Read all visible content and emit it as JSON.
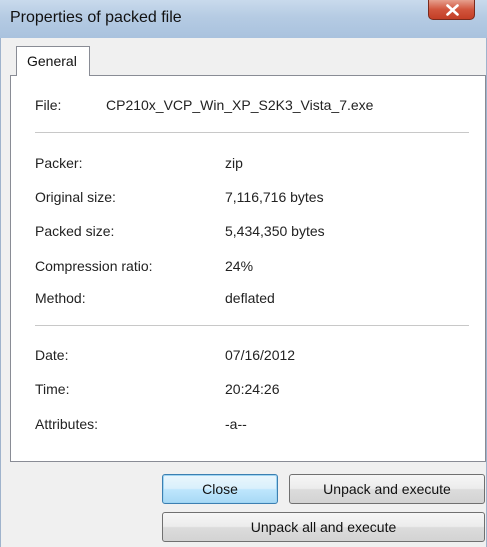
{
  "window": {
    "title": "Properties of packed file",
    "close_glyph": "X"
  },
  "tabs": [
    {
      "label": "General"
    }
  ],
  "file": {
    "label": "File:",
    "value": "CP210x_VCP_Win_XP_S2K3_Vista_7.exe"
  },
  "archive": {
    "packer_label": "Packer:",
    "packer_value": "zip",
    "original_size_label": "Original size:",
    "original_size_value": "7,116,716 bytes",
    "packed_size_label": "Packed size:",
    "packed_size_value": "5,434,350 bytes",
    "ratio_label": "Compression ratio:",
    "ratio_value": "24%",
    "method_label": "Method:",
    "method_value": "deflated"
  },
  "stamp": {
    "date_label": "Date:",
    "date_value": "07/16/2012",
    "time_label": "Time:",
    "time_value": "20:24:26",
    "attributes_label": "Attributes:",
    "attributes_value": "-a--"
  },
  "buttons": {
    "close": "Close",
    "unpack_execute": "Unpack and execute",
    "unpack_all_execute": "Unpack all and execute"
  },
  "colors": {
    "titlebar": "#b5cbe3",
    "close_button": "#c33e26",
    "default_button_border": "#3c7fb1"
  }
}
